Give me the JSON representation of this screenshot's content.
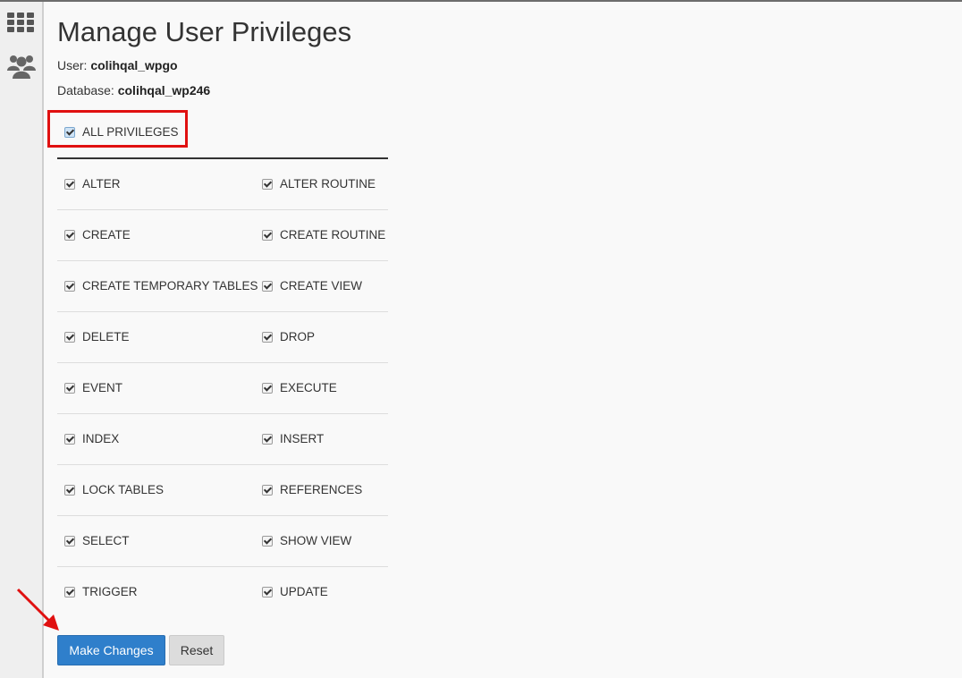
{
  "page": {
    "title": "Manage User Privileges",
    "user_label": "User:",
    "user_value": "colihqal_wpgo",
    "database_label": "Database:",
    "database_value": "colihqal_wp246"
  },
  "sidebar": {
    "items": [
      {
        "icon": "apps-grid-icon"
      },
      {
        "icon": "users-icon"
      }
    ]
  },
  "all_privileges": {
    "label": "ALL PRIVILEGES",
    "checked": true
  },
  "privileges": [
    {
      "left": "ALTER",
      "right": "ALTER ROUTINE"
    },
    {
      "left": "CREATE",
      "right": "CREATE ROUTINE"
    },
    {
      "left": "CREATE TEMPORARY TABLES",
      "right": "CREATE VIEW"
    },
    {
      "left": "DELETE",
      "right": "DROP"
    },
    {
      "left": "EVENT",
      "right": "EXECUTE"
    },
    {
      "left": "INDEX",
      "right": "INSERT"
    },
    {
      "left": "LOCK TABLES",
      "right": "REFERENCES"
    },
    {
      "left": "SELECT",
      "right": "SHOW VIEW"
    },
    {
      "left": "TRIGGER",
      "right": "UPDATE"
    }
  ],
  "buttons": {
    "make_changes": "Make Changes",
    "reset": "Reset"
  },
  "colors": {
    "accent": "#2f7fcb",
    "highlight": "#e01010"
  }
}
